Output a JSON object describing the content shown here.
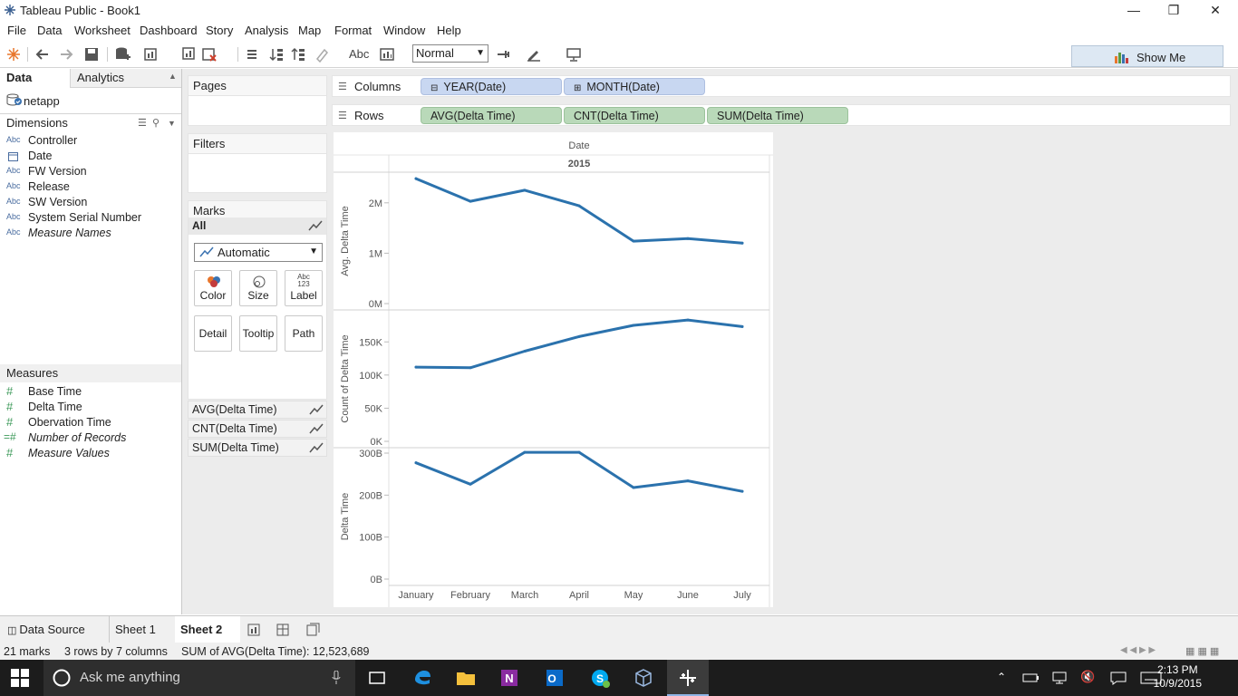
{
  "window": {
    "title": "Tableau Public - Book1"
  },
  "menu": [
    "File",
    "Data",
    "Worksheet",
    "Dashboard",
    "Story",
    "Analysis",
    "Map",
    "Format",
    "Window",
    "Help"
  ],
  "toolbar": {
    "label_abc": "Abc",
    "fit_value": "Normal",
    "show_me": "Show Me"
  },
  "datapane": {
    "tab_data": "Data",
    "tab_analytics": "Analytics",
    "datasource": "netapp",
    "dimensions_header": "Dimensions",
    "dimensions": [
      {
        "icon": "Abc",
        "label": "Controller"
      },
      {
        "icon": "date",
        "label": "Date"
      },
      {
        "icon": "Abc",
        "label": "FW Version"
      },
      {
        "icon": "Abc",
        "label": "Release"
      },
      {
        "icon": "Abc",
        "label": "SW Version"
      },
      {
        "icon": "Abc",
        "label": "System Serial Number"
      },
      {
        "icon": "Abc",
        "label": "Measure Names"
      }
    ],
    "measures_header": "Measures",
    "measures": [
      {
        "icon": "#",
        "label": "Base Time"
      },
      {
        "icon": "#",
        "label": "Delta Time"
      },
      {
        "icon": "#",
        "label": "Obervation Time"
      },
      {
        "icon": "=#",
        "label": "Number of Records"
      },
      {
        "icon": "#",
        "label": "Measure Values"
      }
    ]
  },
  "cards": {
    "pages": "Pages",
    "filters": "Filters",
    "marks": "Marks",
    "marks_all": "All",
    "mark_type": "Automatic",
    "buttons": [
      "Color",
      "Size",
      "Label",
      "Detail",
      "Tooltip",
      "Path"
    ],
    "label_icon_text": "Abc\n123",
    "measure_pills": [
      "AVG(Delta Time)",
      "CNT(Delta Time)",
      "SUM(Delta Time)"
    ]
  },
  "shelves": {
    "columns_label": "Columns",
    "columns": [
      "YEAR(Date)",
      "MONTH(Date)"
    ],
    "rows_label": "Rows",
    "rows": [
      "AVG(Delta Time)",
      "CNT(Delta Time)",
      "SUM(Delta Time)"
    ]
  },
  "chart_data": {
    "type": "line",
    "header": "Date",
    "year": "2015",
    "categories": [
      "January",
      "February",
      "March",
      "April",
      "May",
      "June",
      "July"
    ],
    "color": "#2b72ad",
    "panes": [
      {
        "ylabel": "Avg. Delta Time",
        "ticks": [
          "0M",
          "1M",
          "2M"
        ],
        "tick_values": [
          0,
          1000000,
          2000000
        ],
        "ylim": [
          0,
          2500000
        ],
        "values": [
          2480000,
          2030000,
          2250000,
          1940000,
          1240000,
          1290000,
          1200000
        ]
      },
      {
        "ylabel": "Count of Delta Time",
        "ticks": [
          "0K",
          "50K",
          "100K",
          "150K"
        ],
        "tick_values": [
          0,
          50000,
          100000,
          150000
        ],
        "ylim": [
          0,
          190000
        ],
        "values": [
          112000,
          111000,
          136000,
          158000,
          175000,
          183000,
          173000
        ]
      },
      {
        "ylabel": "Delta Time",
        "ticks": [
          "0B",
          "100B",
          "200B",
          "300B"
        ],
        "tick_values": [
          0,
          100000000000,
          200000000000,
          300000000000
        ],
        "ylim": [
          0,
          300000000000
        ],
        "values": [
          277000000000,
          226000000000,
          302000000000,
          302000000000,
          218000000000,
          234000000000,
          209000000000
        ]
      }
    ]
  },
  "sheet_tabs": {
    "data_source": "Data Source",
    "sheet1": "Sheet 1",
    "sheet2": "Sheet 2"
  },
  "status": {
    "marks": "21 marks",
    "dims": "3 rows by 7 columns",
    "sum": "SUM of AVG(Delta Time): 12,523,689"
  },
  "taskbar": {
    "search_placeholder": "Ask me anything",
    "time": "2:13 PM",
    "date": "10/9/2015"
  }
}
